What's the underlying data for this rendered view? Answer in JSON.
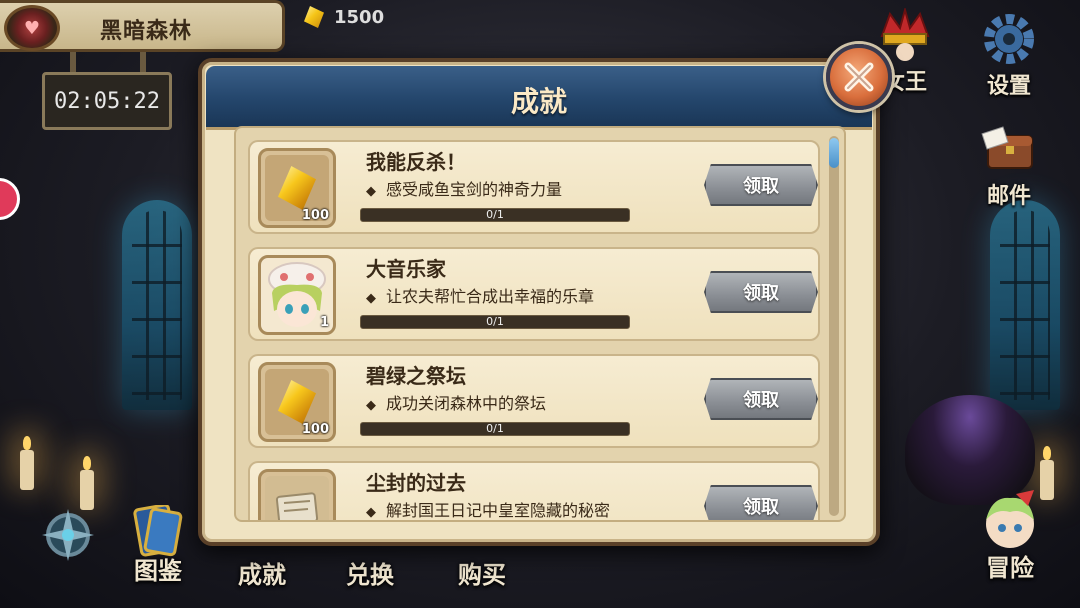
{
  "hud": {
    "region_name": "黑暗森林",
    "currency_value": "1500",
    "timer": "02:05:22"
  },
  "side_menu": {
    "queen_label": "女王",
    "settings_label": "设置",
    "mail_label": "邮件"
  },
  "bottom_bar": {
    "codex_label": "图鉴",
    "achievements_label": "成就",
    "exchange_label": "兑换",
    "shop_label": "购买",
    "adventure_label": "冒险"
  },
  "dialog": {
    "title": "成就",
    "items": [
      {
        "title": "我能反杀！",
        "description": "感受咸鱼宝剑的神奇力量",
        "reward_icon": "gold-gem-icon",
        "reward_qty": "100",
        "progress_text": "0/1",
        "progress": 0,
        "claim_label": "领取"
      },
      {
        "title": "大音乐家",
        "description": "让农夫帮忙合成出幸福的乐章",
        "reward_icon": "character-portrait-icon",
        "reward_qty": "1",
        "progress_text": "0/1",
        "progress": 0,
        "claim_label": "领取"
      },
      {
        "title": "碧绿之祭坛",
        "description": "成功关闭森林中的祭坛",
        "reward_icon": "gold-gem-icon",
        "reward_qty": "100",
        "progress_text": "0/1",
        "progress": 0,
        "claim_label": "领取"
      },
      {
        "title": "尘封的过去",
        "description": "解封国王日记中皇室隐藏的秘密",
        "reward_icon": "diary-page-icon",
        "reward_qty": "",
        "progress_text": "",
        "progress": 0,
        "claim_label": "领取"
      }
    ]
  }
}
